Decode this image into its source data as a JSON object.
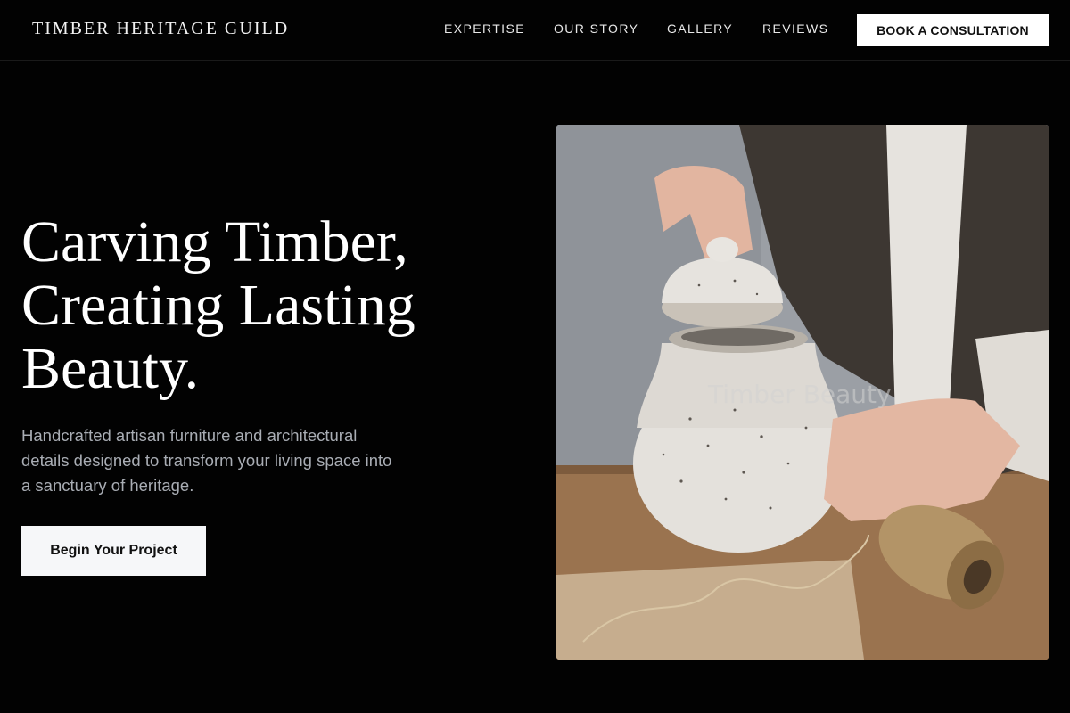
{
  "header": {
    "brand": "TIMBER HERITAGE GUILD",
    "nav": [
      "EXPERTISE",
      "OUR STORY",
      "GALLERY",
      "REVIEWS"
    ],
    "cta": "BOOK A CONSULTATION"
  },
  "hero": {
    "title_lines": [
      "Carving Timber,",
      "Creating Lasting",
      "Beauty."
    ],
    "subtitle": "Handcrafted artisan furniture and architectural details designed to transform your living space into a sanctuary of heritage.",
    "button": "Begin Your Project",
    "image_alt": "Timber Beauty"
  },
  "colors": {
    "background": "#020202",
    "text": "#ffffff",
    "muted_text": "#a9adb4",
    "button_bg": "#f6f7f9"
  }
}
